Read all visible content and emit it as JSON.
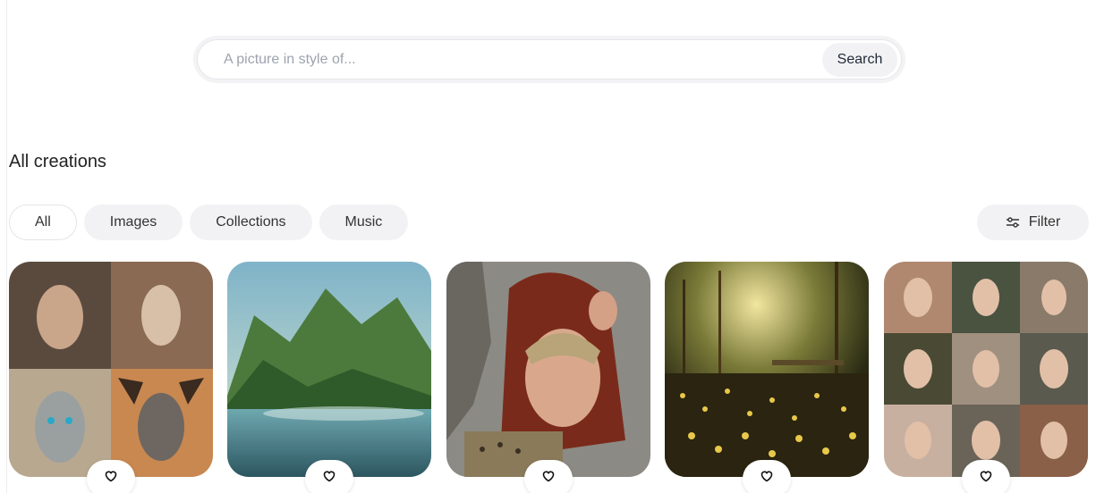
{
  "search": {
    "placeholder": "A picture in style of...",
    "button_label": "Search"
  },
  "section": {
    "title": "All creations"
  },
  "tabs": [
    {
      "label": "All",
      "active": true
    },
    {
      "label": "Images",
      "active": false
    },
    {
      "label": "Collections",
      "active": false
    },
    {
      "label": "Music",
      "active": false
    }
  ],
  "filter": {
    "label": "Filter",
    "icon": "sliders-icon"
  },
  "cards": [
    {
      "subject": "ornate masked faces grid",
      "like_icon": "heart-icon"
    },
    {
      "subject": "misty mountain lake landscape",
      "like_icon": "heart-icon"
    },
    {
      "subject": "red-haired warrior woman",
      "like_icon": "heart-icon"
    },
    {
      "subject": "glowing lantern pond",
      "like_icon": "heart-icon"
    },
    {
      "subject": "portrait grid of women",
      "like_icon": "heart-icon"
    }
  ],
  "colors": {
    "pill_bg": "#f2f2f4",
    "border": "#e5e5e8",
    "placeholder": "#9ca3af"
  }
}
